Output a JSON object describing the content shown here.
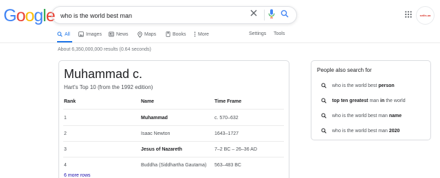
{
  "logo": {
    "letters": [
      "G",
      "o",
      "o",
      "g",
      "l",
      "e"
    ],
    "colors": [
      "#4285f4",
      "#ea4335",
      "#fbbc05",
      "#4285f4",
      "#34a853",
      "#ea4335"
    ]
  },
  "search": {
    "query": "who is the world best man"
  },
  "avatar": {
    "label": "svilis.ua"
  },
  "tabs": [
    {
      "label": "All",
      "icon": "search-icon"
    },
    {
      "label": "Images",
      "icon": "image-icon"
    },
    {
      "label": "News",
      "icon": "news-icon"
    },
    {
      "label": "Maps",
      "icon": "map-pin-icon"
    },
    {
      "label": "Books",
      "icon": "book-icon"
    },
    {
      "label": "More",
      "icon": "more-vert-icon"
    },
    {
      "label": "Settings"
    },
    {
      "label": "Tools"
    }
  ],
  "result_stats": "About 6,350,000,000 results (0.64 seconds)",
  "card": {
    "title": "Muhammad c.",
    "subtitle": "Hart's Top 10 (from the 1992 edition)",
    "headers": {
      "rank": "Rank",
      "name": "Name",
      "time": "Time Frame"
    },
    "rows": [
      {
        "rank": "1",
        "name": "Muhammad",
        "time": "c. 570–632",
        "bold": true
      },
      {
        "rank": "2",
        "name": "Isaac Newton",
        "time": "1643–1727",
        "bold": false
      },
      {
        "rank": "3",
        "name": "Jesus of Nazareth",
        "time": "7–2 BC – 26–36 AD",
        "bold": true
      },
      {
        "rank": "4",
        "name": "Buddha (Siddhartha Gautama)",
        "time": "563–483 BC",
        "bold": false
      }
    ],
    "more_rows": "6 more rows"
  },
  "people_also_search": {
    "title": "People also search for",
    "items": [
      {
        "plain": "who is the world best ",
        "bold": "person",
        "tail": ""
      },
      {
        "plain": "",
        "bold": "top ten greatest",
        "tail": " man ",
        "bold2": "in",
        "tail2": " the world"
      },
      {
        "plain": "who is the world best man ",
        "bold": "name",
        "tail": ""
      },
      {
        "plain": "who is the world best man ",
        "bold": "2020",
        "tail": ""
      }
    ]
  },
  "colors": {
    "accent": "#1a73e8",
    "link": "#1a0dab",
    "border": "#dadce0"
  }
}
